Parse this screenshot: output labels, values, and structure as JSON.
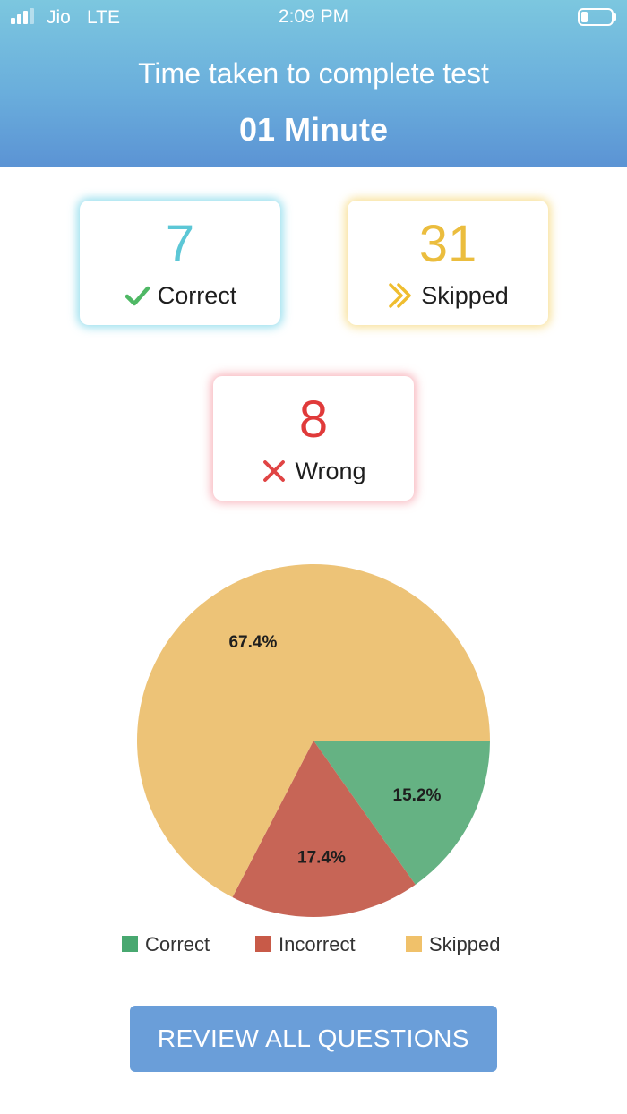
{
  "status_bar": {
    "carrier": "Jio",
    "network": "LTE",
    "time": "2:09 PM"
  },
  "header": {
    "title": "Time taken to complete test",
    "value": "01 Minute"
  },
  "stats": {
    "correct": {
      "count": "7",
      "label": "Correct",
      "color": "#5cc7d6",
      "icon": "check-icon"
    },
    "skipped": {
      "count": "31",
      "label": "Skipped",
      "color": "#ebbd3e",
      "icon": "double-chevron-right-icon"
    },
    "wrong": {
      "count": "8",
      "label": "Wrong",
      "color": "#e03a3a",
      "icon": "x-icon"
    }
  },
  "chart_data": {
    "type": "pie",
    "slices": [
      {
        "name": "Correct",
        "value": 15.2,
        "label": "15.2%",
        "color": "#65b283"
      },
      {
        "name": "Incorrect",
        "value": 17.4,
        "label": "17.4%",
        "color": "#c76556"
      },
      {
        "name": "Skipped",
        "value": 67.4,
        "label": "67.4%",
        "color": "#edc377"
      }
    ],
    "legend": [
      "Correct",
      "Incorrect",
      "Skipped"
    ],
    "legend_colors": [
      "#48a870",
      "#c85a48",
      "#f0c16a"
    ],
    "legend_position": "bottom"
  },
  "review_button": {
    "label": "REVIEW ALL QUESTIONS"
  }
}
